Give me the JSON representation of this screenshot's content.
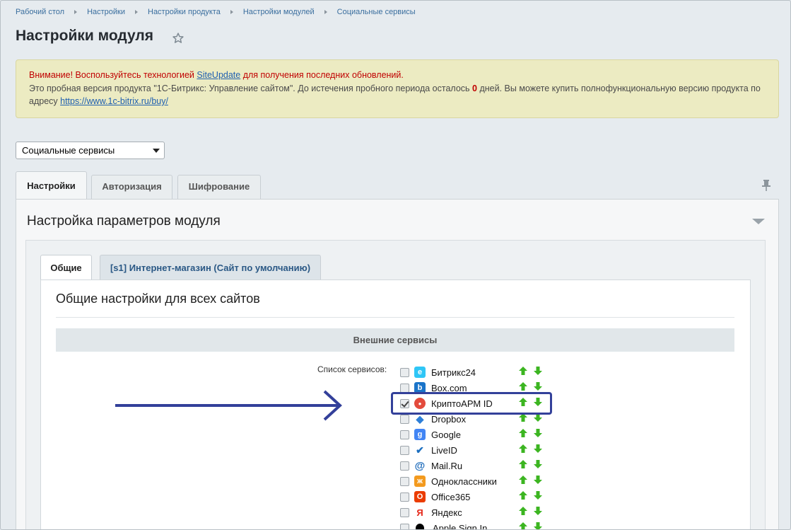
{
  "breadcrumb": [
    "Рабочий стол",
    "Настройки",
    "Настройки продукта",
    "Настройки модулей",
    "Социальные сервисы"
  ],
  "page": {
    "title": "Настройки модуля"
  },
  "notice": {
    "warning_prefix": "Внимание! Воспользуйтесь технологией ",
    "warning_link": "SiteUpdate",
    "warning_suffix": " для получения последних обновлений.",
    "trial_prefix": "Это пробная версия продукта \"1С-Битрикс: Управление сайтом\". До истечения пробного периода осталось ",
    "trial_days": "0",
    "trial_middle": " дней. Вы можете купить полнофункциональную версию продукта по адресу ",
    "trial_link": "https://www.1c-bitrix.ru/buy/"
  },
  "module_select": {
    "value": "Социальные сервисы"
  },
  "tabs": [
    {
      "label": "Настройки"
    },
    {
      "label": "Авторизация"
    },
    {
      "label": "Шифрование"
    }
  ],
  "panel": {
    "title": "Настройка параметров модуля"
  },
  "subtabs": [
    {
      "label": "Общие"
    },
    {
      "label": "[s1] Интернет-магазин (Сайт по умолчанию)"
    }
  ],
  "content": {
    "title": "Общие настройки для всех сайтов",
    "section": "Внешние сервисы",
    "list_label": "Список сервисов:"
  },
  "services": [
    {
      "name": "Битрикс24",
      "checked": false,
      "icon": "bitrix24-icon",
      "color": "#2fc6f6"
    },
    {
      "name": "Box.com",
      "checked": false,
      "icon": "box-icon",
      "color": "#1a74c9"
    },
    {
      "name": "КриптоАРМ ID",
      "checked": true,
      "icon": "cryptoarm-icon",
      "color": "#e34b3d"
    },
    {
      "name": "Dropbox",
      "checked": false,
      "icon": "dropbox-icon",
      "color": "#2d7fd8"
    },
    {
      "name": "Google",
      "checked": false,
      "icon": "google-icon",
      "color": "#4285f4"
    },
    {
      "name": "LiveID",
      "checked": false,
      "icon": "liveid-icon",
      "color": "#1c6fc0"
    },
    {
      "name": "Mail.Ru",
      "checked": false,
      "icon": "mailru-icon",
      "color": "#1666b8"
    },
    {
      "name": "Одноклассники",
      "checked": false,
      "icon": "ok-icon",
      "color": "#f39a1e"
    },
    {
      "name": "Office365",
      "checked": false,
      "icon": "office365-icon",
      "color": "#eb3c00"
    },
    {
      "name": "Яндекс",
      "checked": false,
      "icon": "yandex-icon",
      "color": "#ffffff"
    },
    {
      "name": "Apple Sign In",
      "checked": false,
      "icon": "apple-icon",
      "color": "#000000"
    }
  ],
  "colors": {
    "accent": "#33409a",
    "link": "#2a5885",
    "up_down": "#3cb521"
  }
}
